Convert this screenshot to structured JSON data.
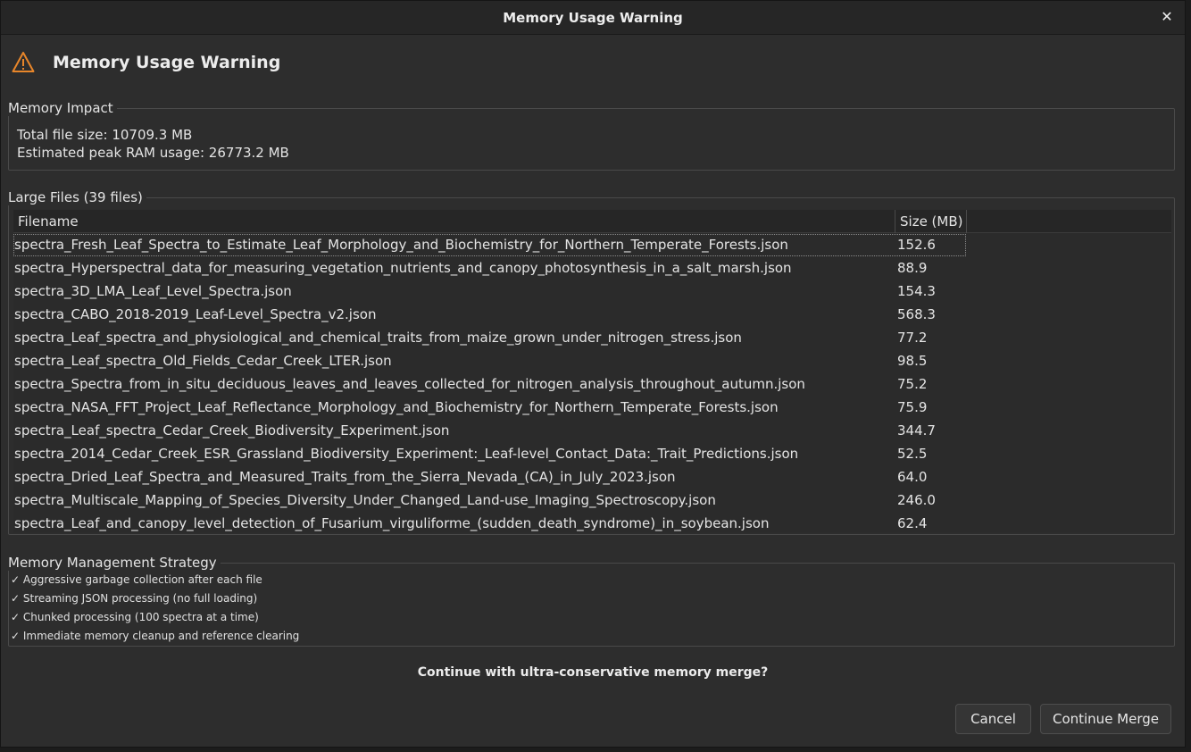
{
  "window": {
    "title": "Memory Usage Warning",
    "close_glyph": "✕"
  },
  "header": {
    "icon": "warning-triangle-icon",
    "title": "Memory Usage Warning"
  },
  "memory_impact": {
    "label": "Memory Impact",
    "total_file_size": "Total file size: 10709.3 MB",
    "estimated_peak_ram": "Estimated peak RAM usage: 26773.2 MB"
  },
  "large_files": {
    "label": "Large Files (39 files)",
    "columns": [
      "Filename",
      "Size (MB)"
    ],
    "rows": [
      {
        "filename": "spectra_Fresh_Leaf_Spectra_to_Estimate_Leaf_Morphology_and_Biochemistry_for_Northern_Temperate_Forests.json",
        "size": "152.6"
      },
      {
        "filename": "spectra_Hyperspectral_data_for_measuring_vegetation_nutrients_and_canopy_photosynthesis_in_a_salt_marsh.json",
        "size": "88.9"
      },
      {
        "filename": "spectra_3D_LMA_Leaf_Level_Spectra.json",
        "size": "154.3"
      },
      {
        "filename": "spectra_CABO_2018-2019_Leaf-Level_Spectra_v2.json",
        "size": "568.3"
      },
      {
        "filename": "spectra_Leaf_spectra_and_physiological_and_chemical_traits_from_maize_grown_under_nitrogen_stress.json",
        "size": "77.2"
      },
      {
        "filename": "spectra_Leaf_spectra_Old_Fields_Cedar_Creek_LTER.json",
        "size": "98.5"
      },
      {
        "filename": "spectra_Spectra_from_in_situ_deciduous_leaves_and_leaves_collected_for_nitrogen_analysis_throughout_autumn.json",
        "size": "75.2"
      },
      {
        "filename": "spectra_NASA_FFT_Project_Leaf_Reflectance_Morphology_and_Biochemistry_for_Northern_Temperate_Forests.json",
        "size": "75.9"
      },
      {
        "filename": "spectra_Leaf_spectra_Cedar_Creek_Biodiversity_Experiment.json",
        "size": "344.7"
      },
      {
        "filename": "spectra_2014_Cedar_Creek_ESR_Grassland_Biodiversity_Experiment:_Leaf-level_Contact_Data:_Trait_Predictions.json",
        "size": "52.5"
      },
      {
        "filename": "spectra_Dried_Leaf_Spectra_and_Measured_Traits_from_the_Sierra_Nevada_(CA)_in_July_2023.json",
        "size": "64.0"
      },
      {
        "filename": "spectra_Multiscale_Mapping_of_Species_Diversity_Under_Changed_Land-use_Imaging_Spectroscopy.json",
        "size": "246.0"
      },
      {
        "filename": "spectra_Leaf_and_canopy_level_detection_of_Fusarium_virguliforme_(sudden_death_syndrome)_in_soybean.json",
        "size": "62.4"
      }
    ]
  },
  "strategy": {
    "label": "Memory Management Strategy",
    "items": [
      "✓ Aggressive garbage collection after each file",
      "✓ Streaming JSON processing (no full loading)",
      "✓ Chunked processing (100 spectra at a time)",
      "✓ Immediate memory cleanup and reference clearing"
    ]
  },
  "question": "Continue with ultra-conservative memory merge?",
  "buttons": {
    "cancel": "Cancel",
    "continue": "Continue Merge"
  },
  "colors": {
    "warning_icon": "#e8862a",
    "background": "#2d2d2d"
  }
}
